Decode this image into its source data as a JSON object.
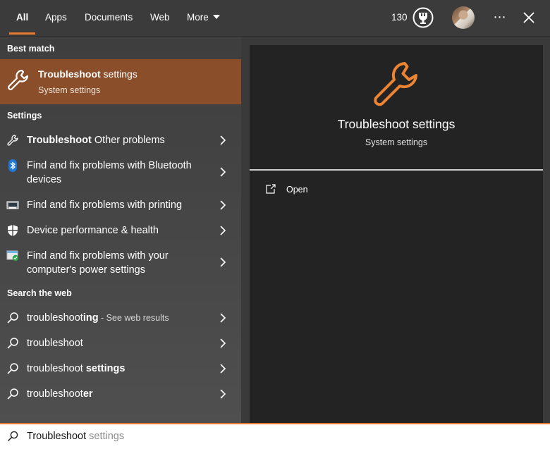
{
  "tabs": [
    {
      "label": "All",
      "active": true
    },
    {
      "label": "Apps"
    },
    {
      "label": "Documents"
    },
    {
      "label": "Web"
    },
    {
      "label": "More"
    }
  ],
  "header": {
    "points": "130",
    "rewards_icon": "rewards-trophy-icon",
    "more_options": "⋯",
    "accent_color": "#e97b2e"
  },
  "best_match": {
    "section_label": "Best match",
    "title_bold": "Troubleshoot",
    "title_rest": " settings",
    "subtitle": "System settings",
    "icon": "wrench-icon",
    "highlight_color": "#8a4f2a"
  },
  "settings": {
    "section_label": "Settings",
    "items": [
      {
        "bold": "Troubleshoot",
        "text": " Other problems",
        "icon": "wrench-icon"
      },
      {
        "bold": "",
        "text": "Find and fix problems with Bluetooth devices",
        "icon": "bluetooth-icon"
      },
      {
        "bold": "",
        "text": "Find and fix problems with printing",
        "icon": "printer-icon"
      },
      {
        "bold": "",
        "text": "Device performance & health",
        "icon": "shield-icon"
      },
      {
        "bold": "",
        "text": "Find and fix problems with your computer's power settings",
        "icon": "power-settings-icon"
      }
    ]
  },
  "web": {
    "section_label": "Search the web",
    "items": [
      {
        "plain": "troubleshoot",
        "bold": "ing",
        "hint": " - See web results"
      },
      {
        "plain": "troubleshoot",
        "bold": "",
        "hint": ""
      },
      {
        "plain": "troubleshoot ",
        "bold": "settings",
        "hint": ""
      },
      {
        "plain": "troubleshoot",
        "bold": "er",
        "hint": ""
      }
    ]
  },
  "preview": {
    "title": "Troubleshoot settings",
    "subtitle": "System settings",
    "icon": "wrench-icon",
    "open_label": "Open",
    "open_icon": "open-external-icon"
  },
  "search": {
    "typed": "Troubleshoot",
    "suggestion": " settings",
    "icon": "search-icon"
  }
}
